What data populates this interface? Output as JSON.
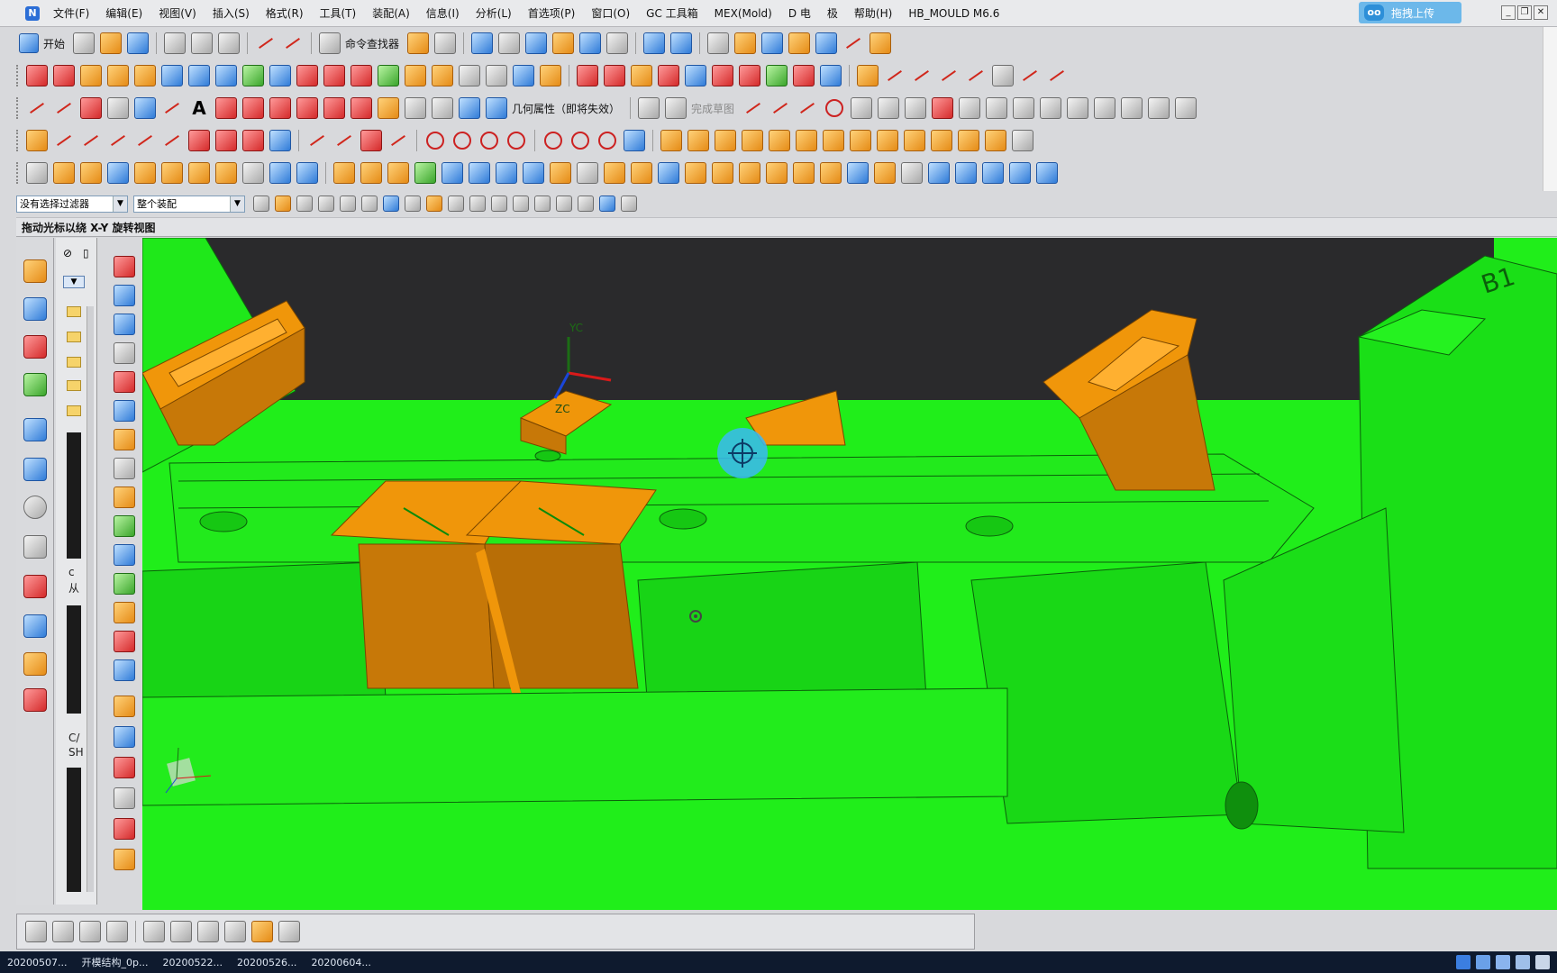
{
  "menu": {
    "items": [
      "文件(F)",
      "编辑(E)",
      "视图(V)",
      "插入(S)",
      "格式(R)",
      "工具(T)",
      "装配(A)",
      "信息(I)",
      "分析(L)",
      "首选项(P)",
      "窗口(O)",
      "GC 工具箱",
      "MEX(Mold)",
      "D 电",
      "极",
      "帮助(H)",
      "HB_MOULD M6.6"
    ],
    "upload_label": "拖拽上传"
  },
  "toolbar1": {
    "start_label": "开始",
    "command_finder_label": "命令查找器"
  },
  "toolbar3": {
    "geometry_properties_label": "几何属性（即将失效）",
    "finish_sketch_label": "完成草图"
  },
  "filter": {
    "selection_filter": "没有选择过滤器",
    "scope": "整个装配"
  },
  "status": {
    "message": "拖动光标以绕 X-Y 旋转视图"
  },
  "viewport": {
    "yc_label": "YC",
    "zc_label": "ZC",
    "part_label": "B1"
  },
  "navigator": {
    "text1": "c",
    "text2": "从",
    "text3": "C/",
    "text4": "SH"
  },
  "taskbar": {
    "items": [
      "20200507...",
      "开模结构_0p...",
      "20200522...",
      "20200526...",
      "20200604..."
    ]
  },
  "colors": {
    "model_green": "#20ee1a",
    "model_orange": "#f0960a",
    "background_dark": "#2a2a2c",
    "upload_blue": "#6cb8ea"
  }
}
